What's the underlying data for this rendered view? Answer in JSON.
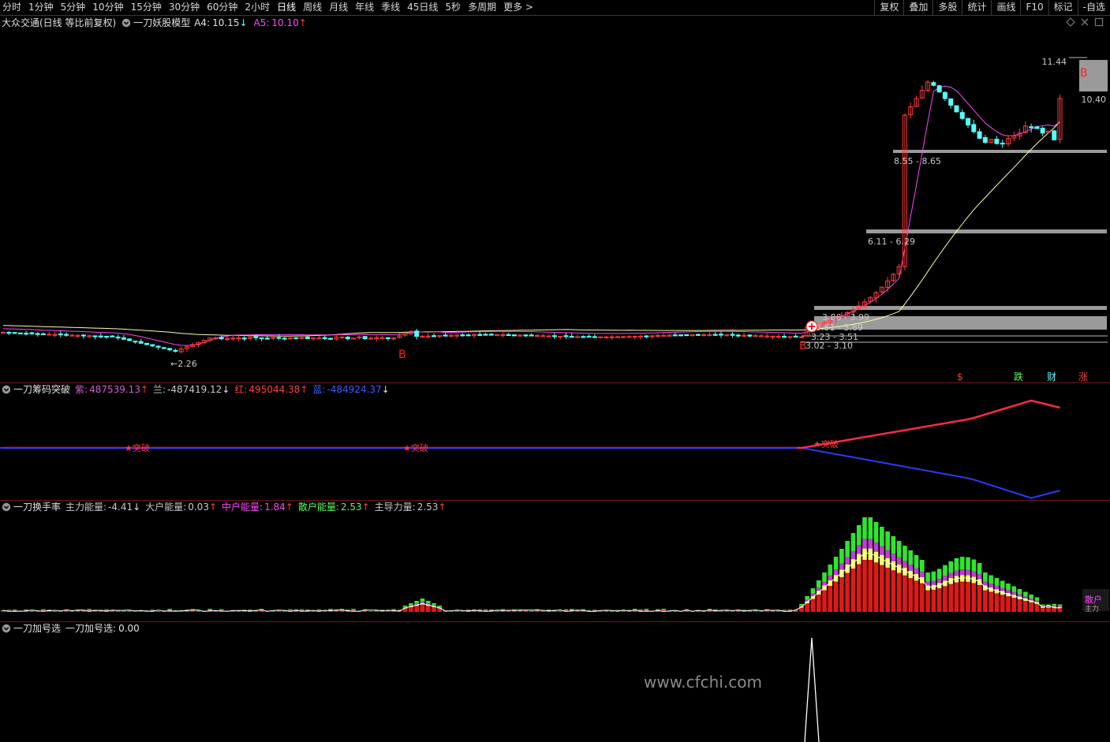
{
  "toolbar": {
    "periods": [
      "分时",
      "1分钟",
      "5分钟",
      "10分钟",
      "15分钟",
      "30分钟",
      "60分钟",
      "2小时",
      "日线",
      "周线",
      "月线",
      "年线",
      "季线",
      "45日线",
      "5秒",
      "多周期",
      "更多 >"
    ],
    "active_period": "日线",
    "right_buttons": [
      "复权",
      "叠加",
      "多股",
      "统计",
      "画线",
      "F10",
      "标记",
      "-自选"
    ]
  },
  "main_panel": {
    "title": "大众交通(日线 等比前复权)",
    "indicator_name": "一刀妖股模型",
    "a4_label": "A4:",
    "a4_value": "10.15",
    "a4_arrow": "↓",
    "a5_label": "A5:",
    "a5_value": "10.10",
    "a5_arrow": "↑",
    "price_high_label": "11.44",
    "price_last_label": "10.40",
    "low_label": "2.26",
    "b_marker": "B",
    "buy_box_label": "B",
    "zones": [
      "8.55 - 8.65",
      "6.11 - 6.29",
      "3.86 - 3.99",
      "3.51 - 3.69",
      "3.23 - 3.51",
      "3.02 - 3.10"
    ],
    "bottom_tags": {
      "s": "$",
      "die": "跌",
      "cai": "财",
      "zhang": "涨"
    },
    "colors": {
      "up": "#ff3b3b",
      "down": "#54ffff",
      "ma_yellow": "#ffff9e",
      "ma_magenta": "#ff47ff",
      "zone_gray": "#9a9a9a"
    }
  },
  "chip_panel": {
    "name": "一刀筹码突破",
    "items": [
      {
        "label": "紫:",
        "value": "487539.13",
        "arrow": "↑",
        "color": "#d35bd3"
      },
      {
        "label": "兰:",
        "value": "-487419.12",
        "arrow": "↓",
        "color": "#c8c8c8"
      },
      {
        "label": "红:",
        "value": "495044.38",
        "arrow": "↑",
        "color": "#ff4040"
      },
      {
        "label": "蓝:",
        "value": "-484924.37",
        "arrow": "↓",
        "color": "#3b5bff"
      }
    ],
    "break_label": "★突破",
    "colors": {
      "red_line": "#ff2a4a",
      "blue_line": "#2a3bff"
    }
  },
  "turnover_panel": {
    "name": "一刀换手率",
    "items": [
      {
        "label": "主力能量:",
        "value": "-4.41",
        "arrow": "↓",
        "color": "#c8c8c8"
      },
      {
        "label": "大户能量:",
        "value": "0.03",
        "arrow": "↑",
        "color": "#c8c8c8"
      },
      {
        "label": "中户能量:",
        "value": "1.84",
        "arrow": "↑",
        "color": "#ff47ff"
      },
      {
        "label": "散户能量:",
        "value": "2.53",
        "arrow": "↑",
        "color": "#54ff54"
      },
      {
        "label": "主导力量:",
        "value": "2.53",
        "arrow": "↑",
        "color": "#c8c8c8"
      }
    ],
    "right_label_1": "散户",
    "right_label_2": "主力",
    "colors": {
      "green": "#2ee62e",
      "magenta": "#c43bd9",
      "yellow": "#ffff66",
      "red": "#e01818"
    }
  },
  "signal_panel": {
    "name": "一刀加号选",
    "label": "一刀加号选:",
    "value": "0.00"
  },
  "watermark": "www.cfchi.com"
}
